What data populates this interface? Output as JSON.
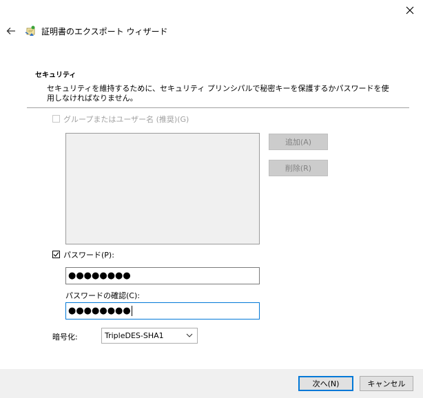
{
  "window": {
    "title": "証明書のエクスポート ウィザード",
    "close_icon": "close-icon",
    "back_icon": "arrow-left-icon"
  },
  "section": {
    "heading": "セキュリティ",
    "description": "セキュリティを維持するために、セキュリティ プリンシパルで秘密キーを保護するかパスワードを使用しなければなりません。"
  },
  "group_option": {
    "label": "グループまたはユーザー名 (推奨)(G)",
    "checked": false,
    "enabled": false
  },
  "group_buttons": {
    "add": "追加(A)",
    "remove": "削除(R)"
  },
  "password_option": {
    "label": "パスワード(P):",
    "checked": true,
    "value": "●●●●●●●●"
  },
  "confirm_password": {
    "label": "パスワードの確認(C):",
    "value": "●●●●●●●●"
  },
  "encryption": {
    "label": "暗号化:",
    "selected": "TripleDES-SHA1"
  },
  "footer": {
    "next": "次へ(N)",
    "cancel": "キャンセル"
  },
  "colors": {
    "focus_border": "#0078d7",
    "disabled_text": "#a0a0a0",
    "footer_bg": "#f0f0f0"
  }
}
